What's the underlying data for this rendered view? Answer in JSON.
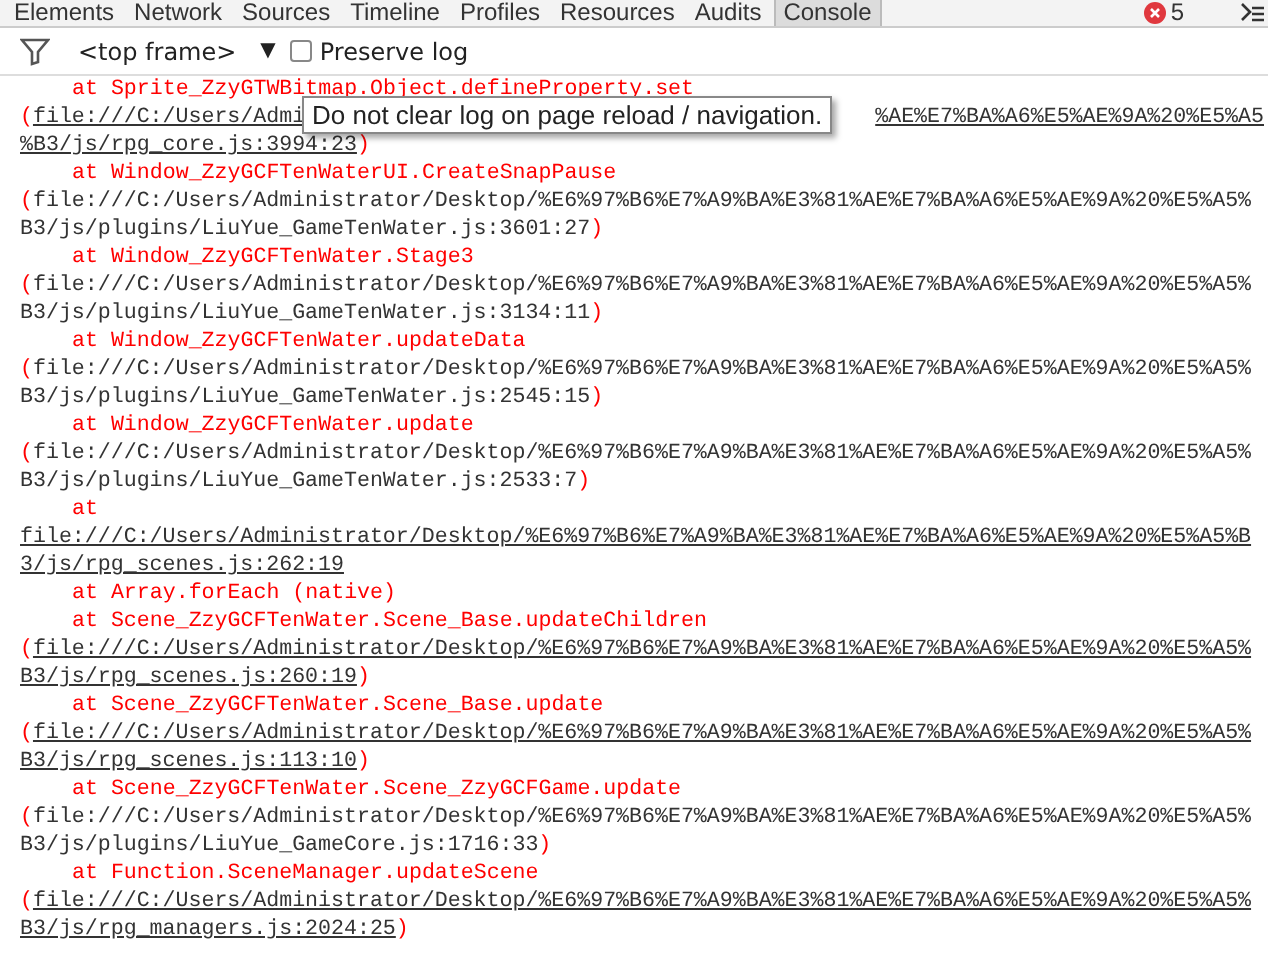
{
  "tabs": [
    {
      "label": "Elements",
      "selected": false
    },
    {
      "label": "Network",
      "selected": false
    },
    {
      "label": "Sources",
      "selected": false
    },
    {
      "label": "Timeline",
      "selected": false
    },
    {
      "label": "Profiles",
      "selected": false
    },
    {
      "label": "Resources",
      "selected": false
    },
    {
      "label": "Audits",
      "selected": false
    },
    {
      "label": "Console",
      "selected": true
    }
  ],
  "error_count": "5",
  "toolbar": {
    "context": "<top frame>",
    "dropdown_arrow": "▼",
    "preserve_log": {
      "label": "Preserve log",
      "checked": false
    }
  },
  "tooltip": "Do not clear log on page reload / navigation.",
  "frames": [
    {
      "kind": "covered",
      "call": "at Sprite_ZzyGTWBitmap.Object.defineProperty.set",
      "visible_start": "(file:///C:/Users/Admi",
      "visible_end": "%AE%E7%BA%A6%E5%AE%9A%20%E5%A5",
      "second_line": "%B3/js/rpg_core.js:3994:23)",
      "linked": true
    },
    {
      "kind": "frame",
      "call": "at Window_ZzyGCFTenWaterUI.CreateSnapPause",
      "location": "(file:///C:/Users/Administrator/Desktop/%E6%97%B6%E7%A9%BA%E3%81%AE%E7%BA%A6%E5%AE%9A%20%E5%A5%B3/js/plugins/LiuYue_GameTenWater.js:3601:27)",
      "parens": true,
      "linked": false
    },
    {
      "kind": "frame",
      "call": "at Window_ZzyGCFTenWater.Stage3",
      "location": "(file:///C:/Users/Administrator/Desktop/%E6%97%B6%E7%A9%BA%E3%81%AE%E7%BA%A6%E5%AE%9A%20%E5%A5%B3/js/plugins/LiuYue_GameTenWater.js:3134:11)",
      "parens": true,
      "linked": false
    },
    {
      "kind": "frame",
      "call": "at Window_ZzyGCFTenWater.updateData",
      "location": "(file:///C:/Users/Administrator/Desktop/%E6%97%B6%E7%A9%BA%E3%81%AE%E7%BA%A6%E5%AE%9A%20%E5%A5%B3/js/plugins/LiuYue_GameTenWater.js:2545:15)",
      "parens": true,
      "linked": false
    },
    {
      "kind": "frame",
      "call": "at Window_ZzyGCFTenWater.update",
      "location": "(file:///C:/Users/Administrator/Desktop/%E6%97%B6%E7%A9%BA%E3%81%AE%E7%BA%A6%E5%AE%9A%20%E5%A5%B3/js/plugins/LiuYue_GameTenWater.js:2533:7)",
      "parens": true,
      "linked": false
    },
    {
      "kind": "frame",
      "call": "at",
      "location": "file:///C:/Users/Administrator/Desktop/%E6%97%B6%E7%A9%BA%E3%81%AE%E7%BA%A6%E5%AE%9A%20%E5%A5%B3/js/rpg_scenes.js:262:19",
      "parens": false,
      "linked": true
    },
    {
      "kind": "native",
      "call": "at Array.forEach (native)"
    },
    {
      "kind": "frame",
      "call": "at Scene_ZzyGCFTenWater.Scene_Base.updateChildren",
      "location": "(file:///C:/Users/Administrator/Desktop/%E6%97%B6%E7%A9%BA%E3%81%AE%E7%BA%A6%E5%AE%9A%20%E5%A5%B3/js/rpg_scenes.js:260:19)",
      "parens": true,
      "linked": true
    },
    {
      "kind": "frame",
      "call": "at Scene_ZzyGCFTenWater.Scene_Base.update",
      "location": "(file:///C:/Users/Administrator/Desktop/%E6%97%B6%E7%A9%BA%E3%81%AE%E7%BA%A6%E5%AE%9A%20%E5%A5%B3/js/rpg_scenes.js:113:10)",
      "parens": true,
      "linked": true
    },
    {
      "kind": "frame",
      "call": "at Scene_ZzyGCFTenWater.Scene_ZzyGCFGame.update",
      "location": "(file:///C:/Users/Administrator/Desktop/%E6%97%B6%E7%A9%BA%E3%81%AE%E7%BA%A6%E5%AE%9A%20%E5%A5%B3/js/plugins/LiuYue_GameCore.js:1716:33)",
      "parens": true,
      "linked": false
    },
    {
      "kind": "frame",
      "call": "at Function.SceneManager.updateScene",
      "location": "(file:///C:/Users/Administrator/Desktop/%E6%97%B6%E7%A9%BA%E3%81%AE%E7%BA%A6%E5%AE%9A%20%E5%A5%B3/js/rpg_managers.js:2024:25)",
      "parens": true,
      "linked": true
    }
  ]
}
